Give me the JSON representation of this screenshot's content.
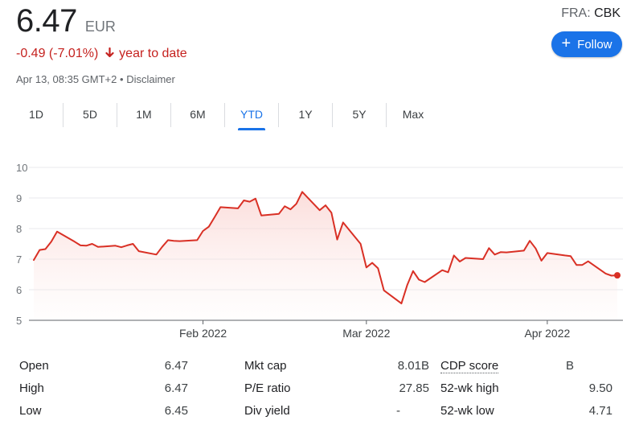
{
  "quote": {
    "price": "6.47",
    "currency": "EUR",
    "change": "-0.49 (-7.01%)",
    "change_suffix": "year to date",
    "timestamp": "Apr 13, 08:35 GMT+2",
    "separator": "•",
    "disclaimer": "Disclaimer",
    "exchange": "FRA:",
    "symbol": "CBK",
    "follow_label": "Follow",
    "down_color": "#c5221f",
    "accent_color": "#1a73e8"
  },
  "tabs": [
    {
      "label": "1D"
    },
    {
      "label": "5D"
    },
    {
      "label": "1M"
    },
    {
      "label": "6M"
    },
    {
      "label": "YTD",
      "active": true
    },
    {
      "label": "1Y"
    },
    {
      "label": "5Y"
    },
    {
      "label": "Max"
    }
  ],
  "chart_data": {
    "type": "area",
    "title": "",
    "xlabel": "",
    "ylabel": "",
    "ylim": [
      5,
      10
    ],
    "y_ticks": [
      "10",
      "9",
      "8",
      "7",
      "6",
      "5"
    ],
    "x_ticks": [
      {
        "label": "Feb 2022",
        "x": "2022-02-01"
      },
      {
        "label": "Mar 2022",
        "x": "2022-03-01"
      },
      {
        "label": "Apr 2022",
        "x": "2022-04-01"
      }
    ],
    "xlim": [
      "2022-01-03",
      "2022-04-13"
    ],
    "grid": "horizontal",
    "line_color": "#d93025",
    "series": [
      {
        "points": [
          [
            "2022-01-03",
            6.97
          ],
          [
            "2022-01-04",
            7.3
          ],
          [
            "2022-01-05",
            7.33
          ],
          [
            "2022-01-06",
            7.57
          ],
          [
            "2022-01-07",
            7.9
          ],
          [
            "2022-01-10",
            7.57
          ],
          [
            "2022-01-11",
            7.45
          ],
          [
            "2022-01-12",
            7.44
          ],
          [
            "2022-01-13",
            7.5
          ],
          [
            "2022-01-14",
            7.4
          ],
          [
            "2022-01-17",
            7.44
          ],
          [
            "2022-01-18",
            7.39
          ],
          [
            "2022-01-19",
            7.45
          ],
          [
            "2022-01-20",
            7.5
          ],
          [
            "2022-01-21",
            7.26
          ],
          [
            "2022-01-24",
            7.15
          ],
          [
            "2022-01-25",
            7.4
          ],
          [
            "2022-01-26",
            7.62
          ],
          [
            "2022-01-27",
            7.6
          ],
          [
            "2022-01-28",
            7.59
          ],
          [
            "2022-01-31",
            7.62
          ],
          [
            "2022-02-01",
            7.92
          ],
          [
            "2022-02-02",
            8.06
          ],
          [
            "2022-02-03",
            8.38
          ],
          [
            "2022-02-04",
            8.7
          ],
          [
            "2022-02-07",
            8.66
          ],
          [
            "2022-02-08",
            8.92
          ],
          [
            "2022-02-09",
            8.88
          ],
          [
            "2022-02-10",
            8.98
          ],
          [
            "2022-02-11",
            8.43
          ],
          [
            "2022-02-14",
            8.48
          ],
          [
            "2022-02-15",
            8.73
          ],
          [
            "2022-02-16",
            8.63
          ],
          [
            "2022-02-17",
            8.81
          ],
          [
            "2022-02-18",
            9.2
          ],
          [
            "2022-02-21",
            8.6
          ],
          [
            "2022-02-22",
            8.76
          ],
          [
            "2022-02-23",
            8.52
          ],
          [
            "2022-02-24",
            7.64
          ],
          [
            "2022-02-25",
            8.2
          ],
          [
            "2022-02-28",
            7.5
          ],
          [
            "2022-03-01",
            6.73
          ],
          [
            "2022-03-02",
            6.88
          ],
          [
            "2022-03-03",
            6.7
          ],
          [
            "2022-03-04",
            5.98
          ],
          [
            "2022-03-07",
            5.55
          ],
          [
            "2022-03-08",
            6.15
          ],
          [
            "2022-03-09",
            6.61
          ],
          [
            "2022-03-10",
            6.33
          ],
          [
            "2022-03-11",
            6.25
          ],
          [
            "2022-03-14",
            6.64
          ],
          [
            "2022-03-15",
            6.57
          ],
          [
            "2022-03-16",
            7.12
          ],
          [
            "2022-03-17",
            6.92
          ],
          [
            "2022-03-18",
            7.04
          ],
          [
            "2022-03-21",
            7.0
          ],
          [
            "2022-03-22",
            7.36
          ],
          [
            "2022-03-23",
            7.15
          ],
          [
            "2022-03-24",
            7.23
          ],
          [
            "2022-03-25",
            7.22
          ],
          [
            "2022-03-28",
            7.28
          ],
          [
            "2022-03-29",
            7.6
          ],
          [
            "2022-03-30",
            7.35
          ],
          [
            "2022-03-31",
            6.95
          ],
          [
            "2022-04-01",
            7.2
          ],
          [
            "2022-04-04",
            7.12
          ],
          [
            "2022-04-05",
            7.1
          ],
          [
            "2022-04-06",
            6.81
          ],
          [
            "2022-04-07",
            6.81
          ],
          [
            "2022-04-08",
            6.93
          ],
          [
            "2022-04-11",
            6.53
          ],
          [
            "2022-04-12",
            6.46
          ],
          [
            "2022-04-13",
            6.47
          ]
        ]
      }
    ]
  },
  "stats": [
    {
      "label": "Open",
      "value": "6.47"
    },
    {
      "label": "Mkt cap",
      "value": "8.01B"
    },
    {
      "label": "CDP score",
      "value": "B"
    },
    {
      "label": "High",
      "value": "6.47"
    },
    {
      "label": "P/E ratio",
      "value": "27.85"
    },
    {
      "label": "52-wk high",
      "value": "9.50"
    },
    {
      "label": "Low",
      "value": "6.45"
    },
    {
      "label": "Div yield",
      "value": "-"
    },
    {
      "label": "52-wk low",
      "value": "4.71"
    }
  ]
}
